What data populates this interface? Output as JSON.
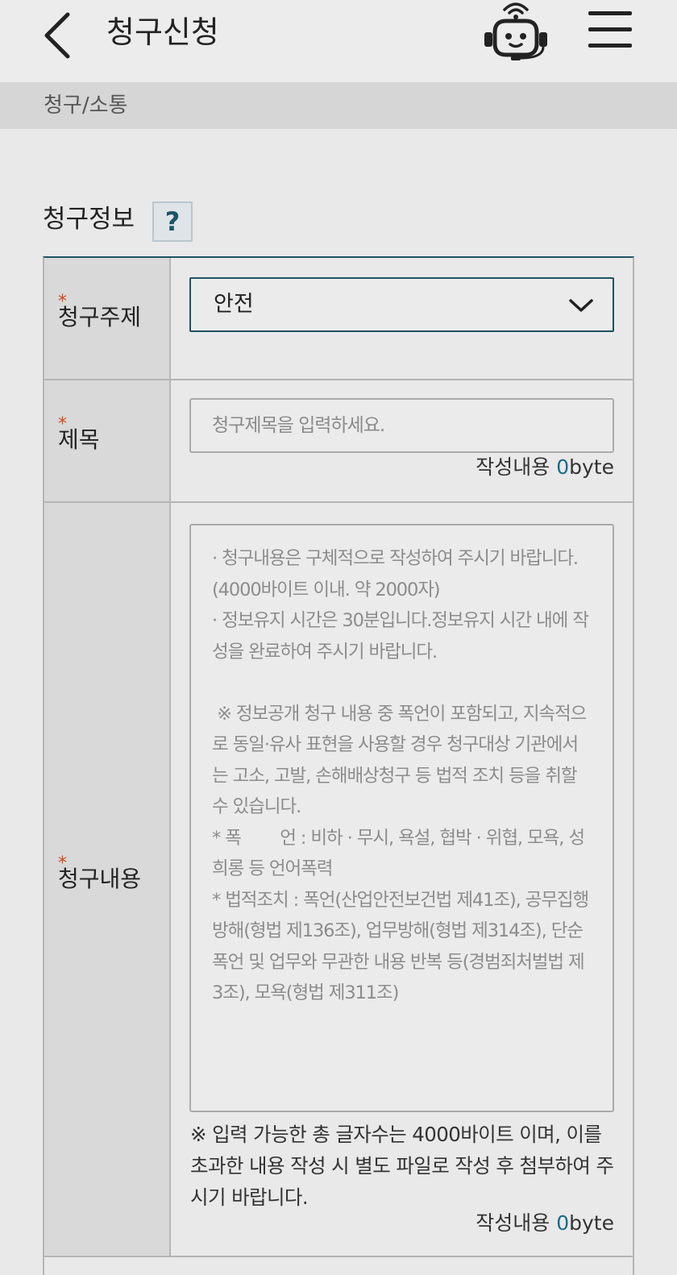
{
  "header": {
    "title": "청구신청",
    "back_icon": "chevron-left-icon",
    "chatbot_icon": "robot-headset-icon",
    "menu_icon": "hamburger-menu-icon"
  },
  "breadcrumb": "청구/소통",
  "section": {
    "title": "청구정보",
    "help_label": "?"
  },
  "form": {
    "required_mark": "*",
    "topic": {
      "label": "청구주제",
      "selected": "안전"
    },
    "subject": {
      "label": "제목",
      "placeholder": "청구제목을 입력하세요.",
      "byte_prefix": "작성내용 ",
      "byte_count": "0",
      "byte_unit": "byte"
    },
    "content": {
      "label": "청구내용",
      "placeholder": "· 청구내용은 구체적으로 작성하여 주시기 바랍니다. (4000바이트 이내. 약 2000자)\n· 정보유지 시간은 30분입니다.정보유지 시간 내에 작성을 완료하여 주시기 바랍니다.\n\n ※ 정보공개 청구 내용 중 폭언이 포함되고, 지속적으로 동일·유사 표현을 사용할 경우 청구대상 기관에서는 고소, 고발, 손해배상청구 등 법적 조치 등을 취할 수 있습니다.\n* 폭        언 : 비하 · 무시, 욕설, 협박 · 위협, 모욕, 성희롱 등 언어폭력\n* 법적조치 : 폭언(산업안전보건법 제41조), 공무집행방해(형법 제136조), 업무방해(형법 제314조), 단순 폭언 및 업무와 무관한 내용 반복 등(경범죄처벌법 제3조), 모욕(형법 제311조)",
      "notice": "※ 입력 가능한 총 글자수는 4000바이트 이며, 이를 초과한 내용 작성 시 별도 파일로 작성 후 첨부하여 주시기 바랍니다.",
      "byte_prefix": "작성내용 ",
      "byte_count": "0",
      "byte_unit": "byte"
    }
  },
  "colors": {
    "accent": "#1f5262",
    "required": "#d04a1c",
    "byte_count": "#1b6b8a"
  }
}
